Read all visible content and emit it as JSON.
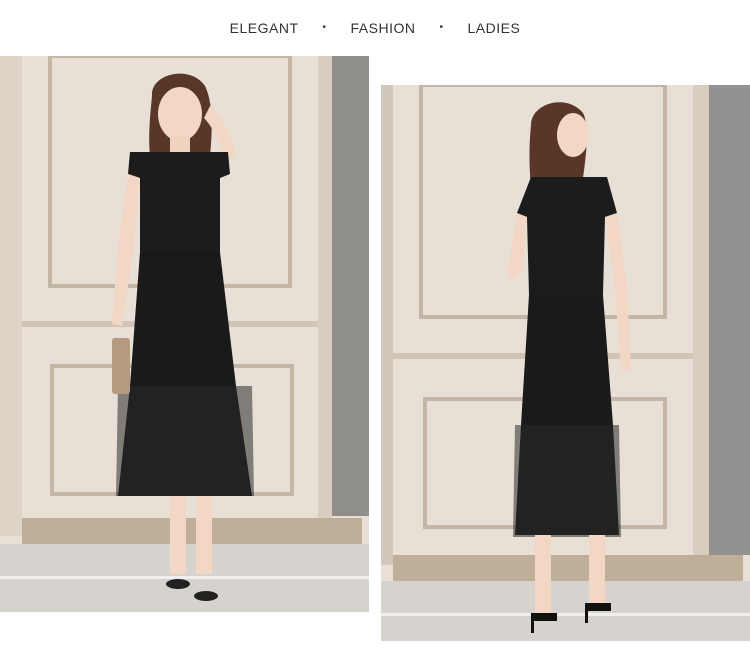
{
  "header": {
    "words": [
      "ELEGANT",
      "FASHION",
      "LADIES"
    ],
    "separator": "•"
  },
  "photos": [
    {
      "subject": "model-front-view"
    },
    {
      "subject": "model-back-view"
    }
  ],
  "colors": {
    "wall": "#e6ddd2",
    "panel_trim": "#c9bcad",
    "floor": "#d9d6d2",
    "dress": "#1b1b1b",
    "skin": "#efd3bf",
    "hair": "#5a3628"
  }
}
